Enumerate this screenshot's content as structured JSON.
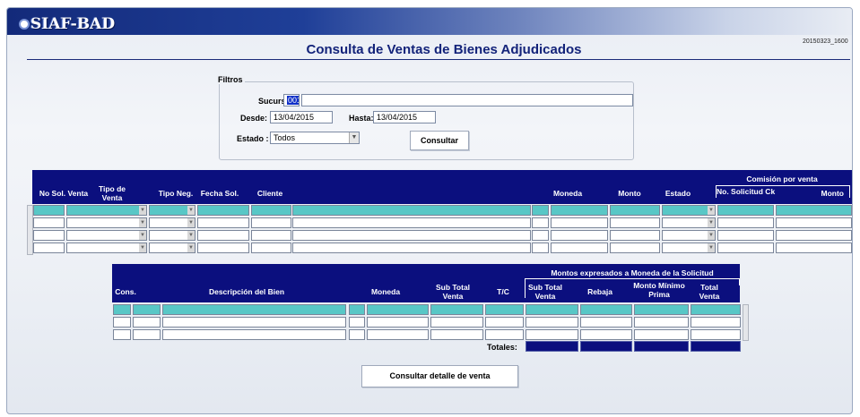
{
  "app": {
    "logo_text": "SIAF-BAD",
    "version": "20150323_1600"
  },
  "page": {
    "title": "Consulta de Ventas de Bienes Adjudicados"
  },
  "filters": {
    "legend": "Filtros",
    "sucursal_label": "Sucursal:",
    "sucursal_code": "001",
    "sucursal_name": "",
    "desde_label": "Desde:",
    "desde_value": "13/04/2015",
    "hasta_label": "Hasta:",
    "hasta_value": "13/04/2015",
    "estado_label": "Estado :",
    "estado_value": "Todos",
    "consultar_label": "Consultar"
  },
  "sales_grid": {
    "group_header": "Comisión por venta",
    "columns": [
      "No Sol. Venta",
      "Tipo de Venta",
      "Tipo Neg.",
      "Fecha Sol.",
      "Cliente",
      "Moneda",
      "Monto",
      "Estado",
      "No. Solicitud Ck",
      "Monto"
    ],
    "rows": 4
  },
  "detail_grid": {
    "group_header": "Montos expresados a Moneda de la Solicitud",
    "columns": [
      "Cons.",
      "Descripción del Bien",
      "Moneda",
      "Sub Total Venta",
      "T/C",
      "Sub Total Venta",
      "Rebaja",
      "Monto Mínimo Prima",
      "Total Venta"
    ],
    "totals_label": "Totales:",
    "rows": 3
  },
  "footer": {
    "detalle_button_label": "Consultar detalle de venta"
  },
  "colors": {
    "header_navy": "#0b0f7e",
    "selected_row_teal": "#58c7c6",
    "title_blue": "#13237a"
  }
}
